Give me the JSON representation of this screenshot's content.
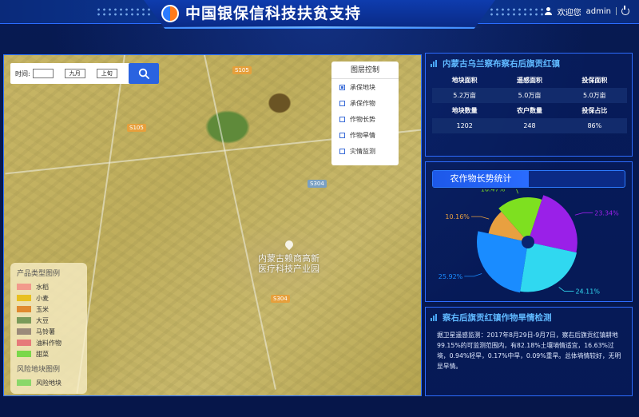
{
  "header": {
    "title": "中国银保信科技扶贫支持",
    "welcome": "欢迎您",
    "username": "admin"
  },
  "map": {
    "search": {
      "time_label": "时间:",
      "year_value": "",
      "month_value": "九月",
      "period_value": "上旬"
    },
    "layer_control": {
      "title": "图层控制",
      "items": [
        {
          "label": "承保地块",
          "checked": true
        },
        {
          "label": "承保作物",
          "checked": false
        },
        {
          "label": "作物长势",
          "checked": false
        },
        {
          "label": "作物旱情",
          "checked": false
        },
        {
          "label": "灾情监测",
          "checked": false
        }
      ]
    },
    "road_tags": [
      "S105",
      "S105",
      "S304",
      "S304"
    ],
    "place_labels": [
      "内蒙古赖商高新",
      "医疗科技产业园"
    ],
    "legend": {
      "product_title": "产品类型图例",
      "product_items": [
        {
          "label": "水稻",
          "color": "#f29a8c"
        },
        {
          "label": "小麦",
          "color": "#e8c020"
        },
        {
          "label": "玉米",
          "color": "#e08a30"
        },
        {
          "label": "大豆",
          "color": "#7a9a5a"
        },
        {
          "label": "马铃薯",
          "color": "#9a8a7a"
        },
        {
          "label": "油料作物",
          "color": "#e67a7a"
        },
        {
          "label": "甜菜",
          "color": "#7ad84a"
        }
      ],
      "risk_title": "风险地块图例",
      "risk_items": [
        {
          "label": "风险地块",
          "color": "#8ad86a"
        }
      ]
    }
  },
  "stats_panel": {
    "title": "内蒙古乌兰察布察右后旗贡红镇",
    "row1_headers": [
      "地块面积",
      "遥感面积",
      "投保面积"
    ],
    "row1_values": [
      "5.2万亩",
      "5.0万亩",
      "5.0万亩"
    ],
    "row2_headers": [
      "地块数量",
      "农户数量",
      "投保占比"
    ],
    "row2_values": [
      "1202",
      "248",
      "86%"
    ]
  },
  "growth_panel": {
    "tab_label": "农作物长势统计"
  },
  "chart_data": {
    "type": "pie",
    "subtype": "rose",
    "title": "农作物长势统计",
    "slices": [
      {
        "value": 25.92,
        "label": "25.92%",
        "color": "#1a8cff"
      },
      {
        "value": 10.16,
        "label": "10.16%",
        "color": "#e8a040"
      },
      {
        "value": 16.47,
        "label": "16.47%",
        "color": "#7ee020"
      },
      {
        "value": 23.34,
        "label": "23.34%",
        "color": "#9a20e8"
      },
      {
        "value": 24.11,
        "label": "24.11%",
        "color": "#30d8f0"
      }
    ]
  },
  "drought_panel": {
    "title": "察右后旗贡红镇作物旱情检测",
    "text": "据卫星遥感监测：2017年8月29日-9月7日，察右后旗贡红镇耕地99.15%的可监测范围内，有82.18%土壤墒情适宜，16.63%过墒，0.94%轻旱，0.17%中旱，0.09%重旱。总体墒情较好，无明显旱情。"
  }
}
